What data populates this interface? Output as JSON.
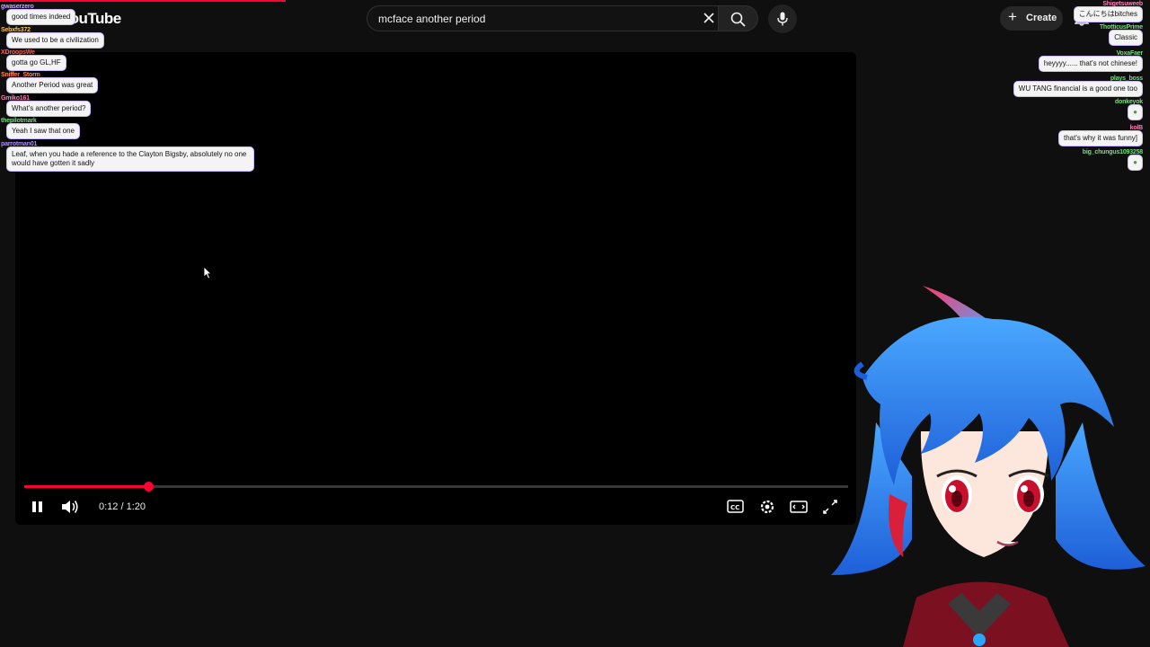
{
  "header": {
    "logo_text": "YouTube",
    "search_value": "mcface another period",
    "create_label": "Create"
  },
  "player": {
    "time_display": "0:12 / 1:20",
    "progress_fraction": 0.15,
    "accent_color": "#ff0033"
  },
  "chat_left": [
    {
      "user": "gwaserzero",
      "user_color": "#c9a7ff",
      "message": "good times indeed"
    },
    {
      "user": "Sebxfs372",
      "user_color": "#f5c542",
      "message": "We used to be a civilization"
    },
    {
      "user": "XDroopsWe",
      "user_color": "#ff5a5a",
      "message": "gotta go GL,HF"
    },
    {
      "user": "Sniffer_Storm",
      "user_color": "#ff8a3d",
      "message": "Another Period was great"
    },
    {
      "user": "Gmiko161",
      "user_color": "#ff7eb6",
      "message": "What's another period?"
    },
    {
      "user": "thepilotmark",
      "user_color": "#6fe07a",
      "message": "Yeah I saw that one"
    },
    {
      "user": "parrotman01",
      "user_color": "#b48cff",
      "message": "Leaf, when you hade a reference to the Clayton Bigsby, absolutely no one would have gotten it sadly"
    }
  ],
  "chat_right": [
    {
      "user": "Shigetsuweeb",
      "user_color": "#ff7eb6",
      "message": "こんにちはbitches"
    },
    {
      "user": "ThotticusPrime",
      "user_color": "#6fe07a",
      "message": "Classic"
    },
    {
      "user": "VoxaFaer",
      "user_color": "#6fe07a",
      "message": "heyyyy...... that's not chinese!"
    },
    {
      "user": "plays_boss",
      "user_color": "#6fe07a",
      "message": "WU TANG financial is a good one too"
    },
    {
      "user": "donkeyok",
      "user_color": "#6fe07a",
      "message": ""
    },
    {
      "user": "kolB",
      "user_color": "#ff7eb6",
      "message": "that's why it was funny]"
    },
    {
      "user": "big_chungus1093258",
      "user_color": "#6fe07a",
      "message": ""
    }
  ]
}
